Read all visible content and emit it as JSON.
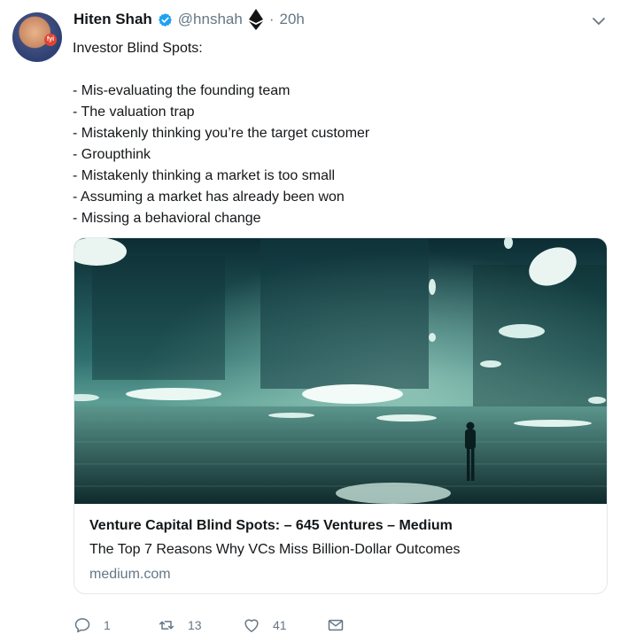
{
  "user": {
    "name": "Hiten Shah",
    "handle": "@hnshah",
    "separator": "·",
    "time": "20h"
  },
  "tweet": {
    "text": "Investor Blind Spots:\n\n- Mis-evaluating the founding team\n- The valuation trap\n- Mistakenly thinking you’re the target customer\n- Groupthink\n- Mistakenly thinking a market is too small\n- Assuming a market has already been won\n- Missing a behavioral change"
  },
  "card": {
    "title": "Venture Capital Blind Spots: – 645 Ventures – Medium",
    "description": "The Top 7 Reasons Why VCs Miss Billion-Dollar Outcomes",
    "domain": "medium.com"
  },
  "actions": {
    "replies": "1",
    "retweets": "13",
    "likes": "41"
  },
  "icons": {
    "verified": "verified-badge-icon",
    "ethereum": "ethereum-icon",
    "more": "chevron-down-icon",
    "reply": "reply-icon",
    "retweet": "retweet-icon",
    "like": "heart-icon",
    "dm": "envelope-icon"
  },
  "colors": {
    "accent": "#1da1f2",
    "muted": "#657786",
    "text": "#14171a"
  }
}
